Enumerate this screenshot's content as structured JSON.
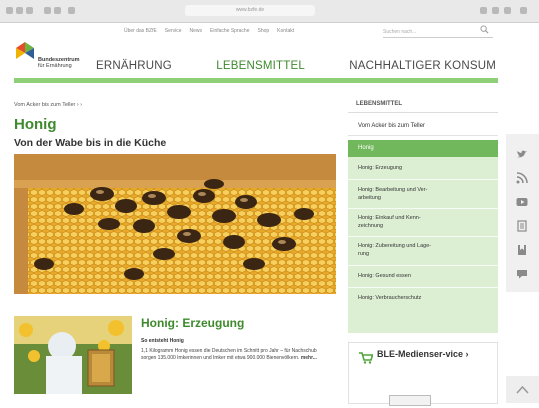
{
  "browser": {
    "url": "www.bzfe.de"
  },
  "header": {
    "top_links": [
      "Über das BZfE",
      "Service",
      "News",
      "Einfache Sprache",
      "Shop",
      "Kontakt"
    ],
    "search_placeholder": "Suchen nach...",
    "logo_line1": "Bundeszentrum",
    "logo_line2": "für Ernährung",
    "nav": [
      "ERNÄHRUNG",
      "LEBENSMITTEL",
      "NACHHALTIGER KONSUM"
    ],
    "nav_active": "LEBENSMITTEL"
  },
  "content": {
    "breadcrumb": "Vom Acker bis zum Teller",
    "title": "Honig",
    "subtitle": "Von der Wabe bis in die Küche",
    "teaser": {
      "title": "Honig: Erzeugung",
      "subtitle": "So entsteht Honig",
      "text": "1,1 Kilogramm Honig essen die Deutschen im Schnitt pro Jahr – für Nachschub sorgen 135.000 Imkerinnen und Imker mit etwa 900.000 Bienenvölkern.",
      "more": "mehr..."
    }
  },
  "sidebar": {
    "heading": "LEBENSMITTEL",
    "top_item": "Vom Acker bis zum Teller",
    "active_item": "Honig",
    "sub_items": [
      [
        "Honig: Erzeugung"
      ],
      [
        "Honig: Bearbeitung und Ver-",
        "arbeitung"
      ],
      [
        "Honig: Einkauf und Kenn-",
        "zeichnung"
      ],
      [
        "Honig: Zubereitung und Lage-",
        "rung"
      ],
      [
        "Honig: Gesund essen"
      ],
      [
        "Honig: Verbraucherschutz"
      ]
    ],
    "media_title": "BLE-Medienser-vice ›"
  },
  "share_icons": [
    "twitter-icon",
    "rss-icon",
    "youtube-icon",
    "print-icon",
    "bookmark-icon",
    "comment-icon"
  ],
  "colors": {
    "brand_green": "#3e8a2d",
    "nav_bar": "#8fcf77",
    "active_item": "#71b85c",
    "sub_bg": "#dcefd3"
  }
}
